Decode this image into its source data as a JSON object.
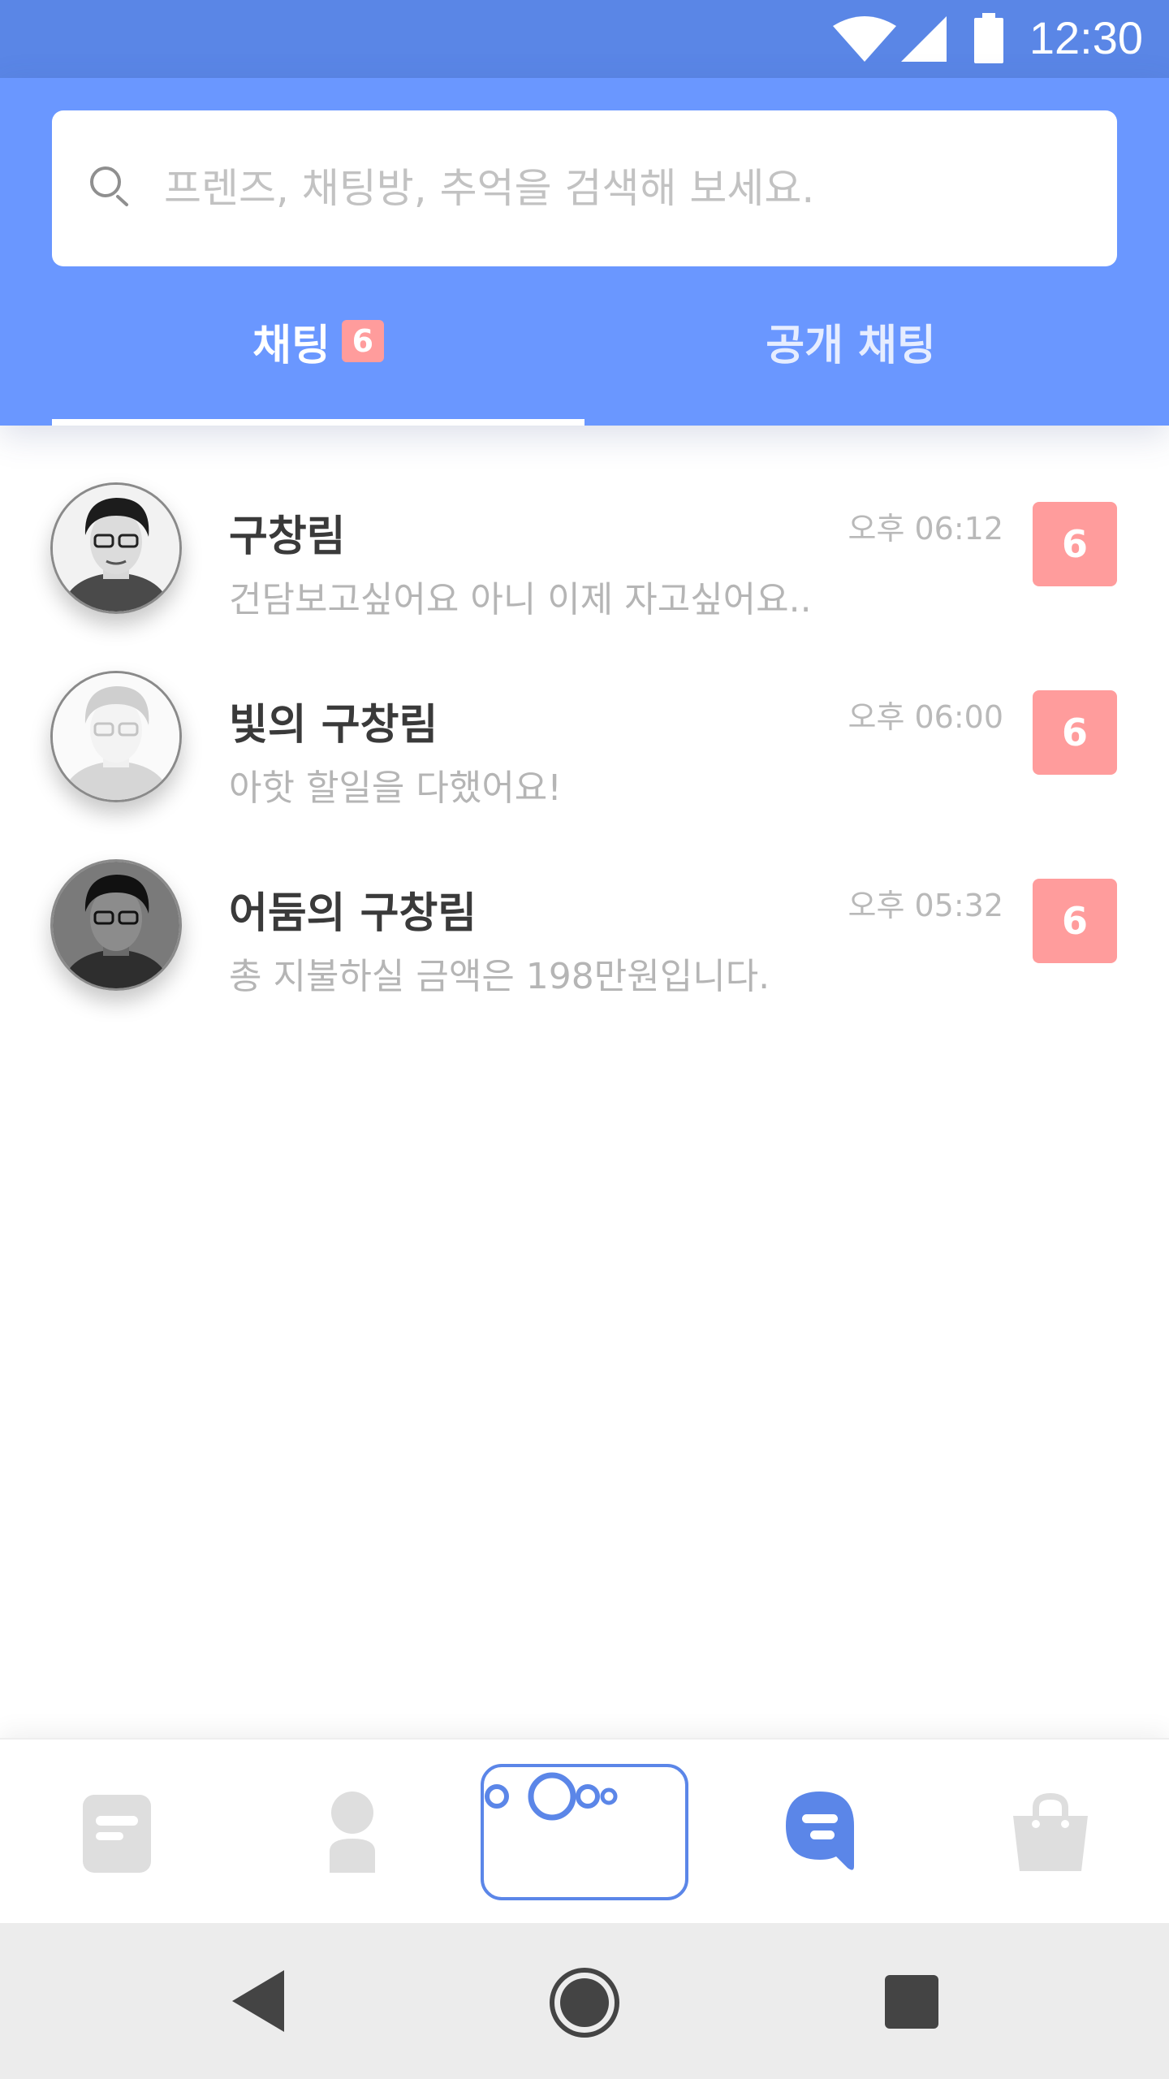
{
  "status_bar": {
    "time": "12:30",
    "icons": [
      "wifi-icon",
      "signal-icon",
      "battery-icon"
    ]
  },
  "search": {
    "placeholder": "프렌즈, 채팅방, 추억을 검색해 보세요.",
    "value": ""
  },
  "tabs": [
    {
      "label": "채팅",
      "badge": "6",
      "active": true
    },
    {
      "label": "공개 채팅",
      "active": false
    }
  ],
  "chats": [
    {
      "name": "구창림",
      "message": "건담보고싶어요 아니 이제 자고싶어요..",
      "time": "오후 06:12",
      "unread": "6",
      "avatar": "avatar-normal"
    },
    {
      "name": "빛의 구창림",
      "message": "아핫 할일을 다했어요!",
      "time": "오후 06:00",
      "unread": "6",
      "avatar": "avatar-light"
    },
    {
      "name": "어둠의 구창림",
      "message": "총 지불하실 금액은 198만원입니다.",
      "time": "오후 05:32",
      "unread": "6",
      "avatar": "avatar-dark"
    }
  ],
  "bottom_nav": [
    {
      "icon": "note-icon",
      "active": false
    },
    {
      "icon": "person-icon",
      "active": false
    },
    {
      "icon": "circles-icon",
      "active": true,
      "highlighted": true
    },
    {
      "icon": "chat-bubble-icon",
      "active": true
    },
    {
      "icon": "shopping-bag-icon",
      "active": false
    }
  ],
  "colors": {
    "status_bar": "#5a86e6",
    "header": "#6a97ff",
    "badge": "#ff9c9c",
    "accent": "#5b86e8",
    "inactive_icon": "#dedede"
  }
}
